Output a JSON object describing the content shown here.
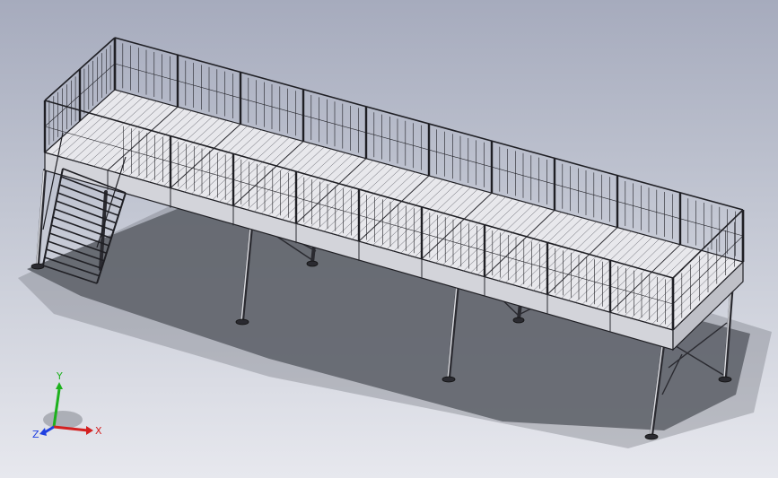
{
  "viewport": {
    "background_top": "#a6abbd",
    "background_bottom": "#e7e8ee"
  },
  "model": {
    "icon": "steel-platform-model",
    "stroke_color": "#1f1f24",
    "deck_color": "#e8e8ec",
    "side_color": "#d3d4da",
    "shadow_color": "#55585f"
  },
  "triad": {
    "x_label": "X",
    "y_label": "Y",
    "z_label": "Z",
    "x_color": "#d42020",
    "y_color": "#1db11d",
    "z_color": "#2040e0"
  }
}
